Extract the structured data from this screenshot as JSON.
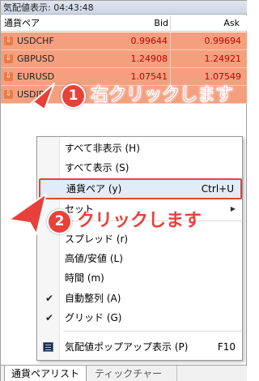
{
  "window": {
    "title": "気配値表示: 04:43:48"
  },
  "columns": {
    "symbol": "通貨ペア",
    "bid": "Bid",
    "ask": "Ask"
  },
  "rows": [
    {
      "symbol": "USDCHF",
      "bid": "0.99644",
      "ask": "0.99694"
    },
    {
      "symbol": "GBPUSD",
      "bid": "1.24908",
      "ask": "1.24921"
    },
    {
      "symbol": "EURUSD",
      "bid": "1.07541",
      "ask": "1.07549"
    },
    {
      "symbol": "USDJPY",
      "bid": "",
      "ask": ""
    }
  ],
  "callouts": {
    "step1_number": "1",
    "step1_text": "右クリックします",
    "step2_number": "2",
    "step2_text": "クリックします"
  },
  "menu": {
    "items": [
      {
        "label": "すべて非表示 (H)",
        "shortcut": ""
      },
      {
        "label": "すべて表示 (S)",
        "shortcut": ""
      },
      {
        "label": "通貨ペア (y)",
        "shortcut": "Ctrl+U"
      },
      {
        "label": "セット",
        "shortcut": ""
      },
      {
        "label": "スプレッド (r)",
        "shortcut": ""
      },
      {
        "label": "高値/安値 (L)",
        "shortcut": ""
      },
      {
        "label": "時間 (m)",
        "shortcut": ""
      },
      {
        "label": "自動整列 (A)",
        "shortcut": ""
      },
      {
        "label": "グリッド (G)",
        "shortcut": ""
      },
      {
        "label": "気配値ポップアップ表示 (P)",
        "shortcut": "F10"
      }
    ]
  },
  "tabs": {
    "active": "通貨ペアリスト",
    "inactive": "ティックチャート"
  },
  "colors": {
    "row_highlight": "#f4a07f",
    "price_text": "#c00000",
    "callout_red": "#e8413a",
    "menu_highlight": "#dbe8f6"
  },
  "icons": [
    "down-arrow-icon",
    "pointer-arrow-icon",
    "check-icon",
    "submenu-arrow-icon",
    "popup-window-icon"
  ]
}
